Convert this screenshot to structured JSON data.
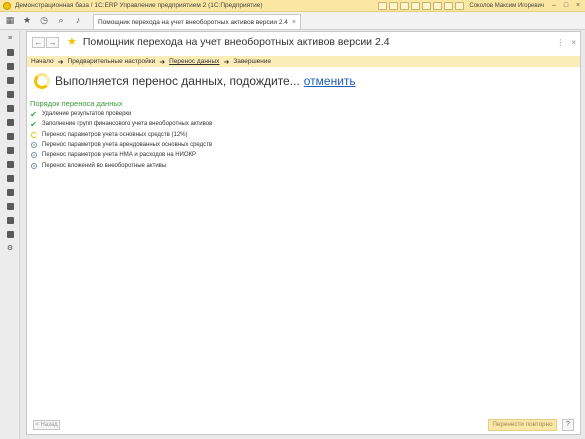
{
  "titlebar": {
    "title": "Демонстрационная база / 1С:ERP Управление предприятием 2 (1С:Предприятие)",
    "user": "Соколов Максим Игоревич"
  },
  "toolbar": {
    "tab_label": "Помощник перехода на учет внеоборотных активов версии 2.4",
    "tab_close": "×"
  },
  "window": {
    "title": "Помощник перехода на учет внеоборотных активов версии 2.4",
    "back": "←",
    "forward": "→",
    "more": "⋮",
    "close": "×"
  },
  "steps": [
    {
      "label": "Начало"
    },
    {
      "label": "Предварительные настройки"
    },
    {
      "label": "Перенос данных"
    },
    {
      "label": "Завершение"
    }
  ],
  "status": {
    "text": "Выполняется перенос данных, подождите...",
    "cancel": "отменить"
  },
  "section_title": "Порядок переноса данных",
  "tasks": [
    {
      "label": "Удаление результатов проверки",
      "state": "done"
    },
    {
      "label": "Заполнение групп финансового учета внеоборотных активов",
      "state": "done"
    },
    {
      "label": "Перенос параметров учета основных средств (12%)",
      "state": "in-progress"
    },
    {
      "label": "Перенос параметров учета арендованных основных средств",
      "state": "pending"
    },
    {
      "label": "Перенос параметров учета НМА и расходов на НИОКР",
      "state": "pending"
    },
    {
      "label": "Перенос вложений во внеоборотные активы",
      "state": "pending"
    }
  ],
  "buttons": {
    "back": "< Назад",
    "retry": "Перенести повторно",
    "help": "?"
  },
  "colors": {
    "accent": "#f2c200",
    "link": "#1f5fb5",
    "section": "#3b9c3b"
  }
}
